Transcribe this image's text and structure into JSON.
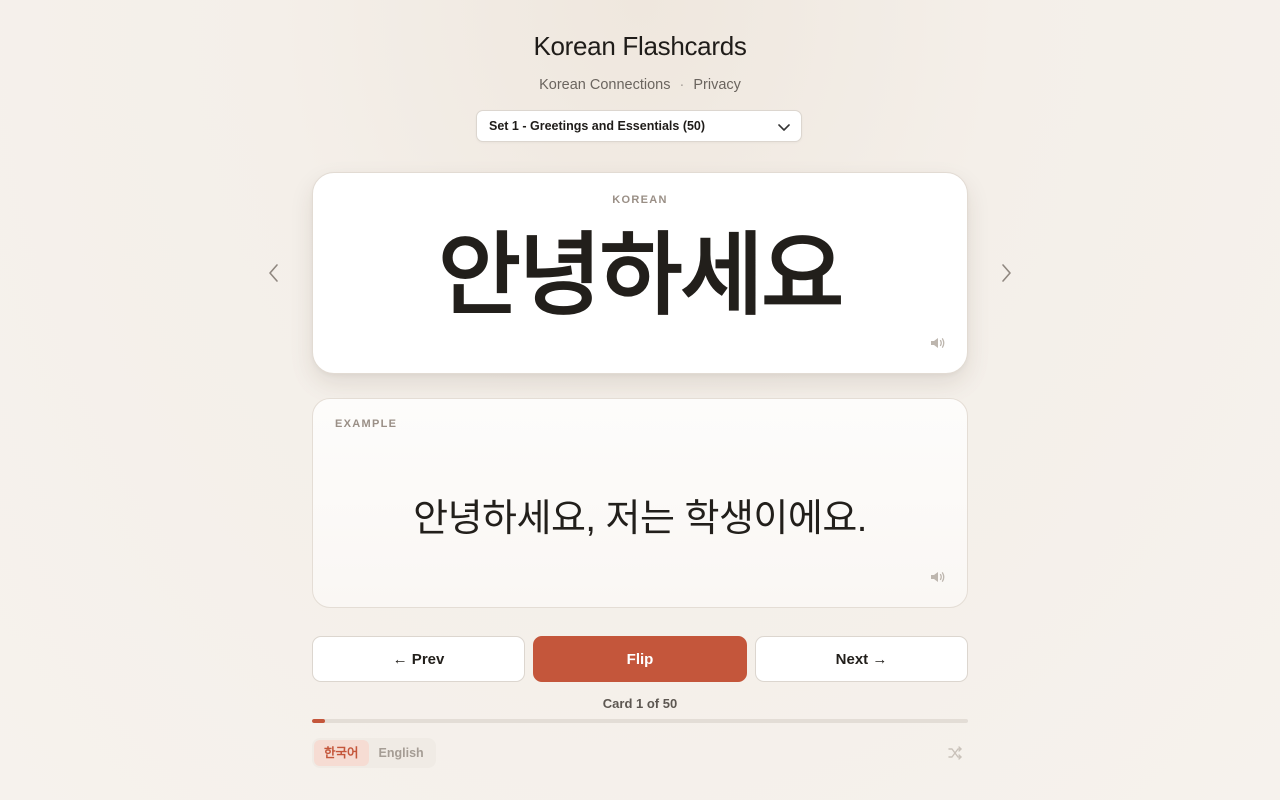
{
  "header": {
    "title": "Korean Flashcards",
    "links": [
      {
        "label": "Korean Connections"
      },
      {
        "label": "Privacy"
      }
    ],
    "separator": "·"
  },
  "set_select": {
    "selected": "Set 1 - Greetings and Essentials (50)"
  },
  "card": {
    "label": "KOREAN",
    "word": "안녕하세요"
  },
  "example": {
    "label": "EXAMPLE",
    "text": "안녕하세요, 저는 학생이에요."
  },
  "controls": {
    "prev_label": "← Prev",
    "flip_label": "Flip",
    "next_label": "Next →"
  },
  "progress": {
    "counter_text": "Card 1 of 50",
    "current": 1,
    "total": 50,
    "fraction": 0.02
  },
  "language_toggle": {
    "options": [
      "한국어",
      "English"
    ],
    "active": "한국어"
  },
  "icons": {
    "speaker": "speaker-icon",
    "shuffle": "shuffle-icon",
    "chevron_left": "chevron-left-icon",
    "chevron_right": "chevron-right-icon",
    "dropdown": "chevron-down-icon"
  },
  "colors": {
    "accent": "#c4563b",
    "background": "#f6f2ed",
    "active_lang_bg": "#f6dcd3"
  }
}
